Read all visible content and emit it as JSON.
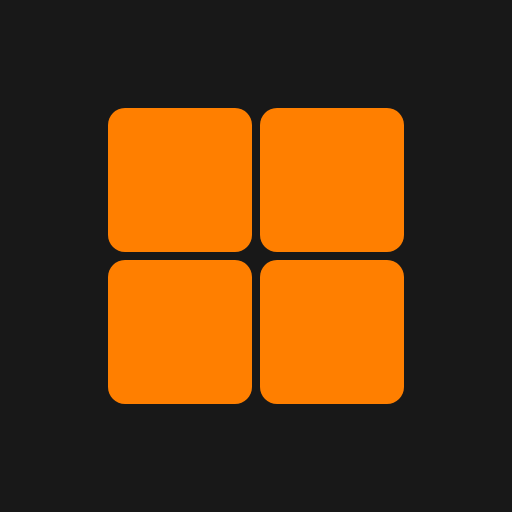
{
  "icon": {
    "name": "grid-icon",
    "tiles": [
      "top-left",
      "top-right",
      "bottom-left",
      "bottom-right"
    ]
  },
  "colors": {
    "background": "#181818",
    "tile": "#ff7f00"
  }
}
